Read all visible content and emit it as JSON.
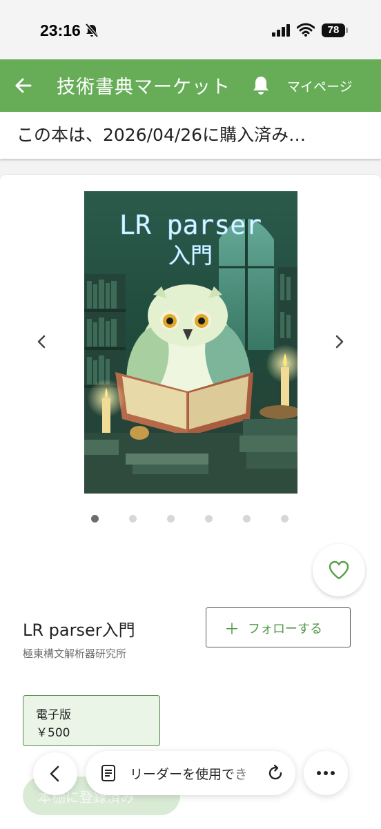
{
  "status_bar": {
    "time": "23:16",
    "battery": "78",
    "icons": [
      "bell-off-icon",
      "signal-icon",
      "wifi-icon",
      "battery-icon"
    ]
  },
  "app_bar": {
    "title": "技術書典マーケット",
    "mypage_label": "マイページ",
    "icons": [
      "back-arrow-icon",
      "bell-icon"
    ],
    "background": "#67ad58"
  },
  "purchase_notice": "この本は、2026/04/26に購入済み…",
  "book": {
    "cover_title_line1": "LR parser",
    "cover_title_line2": "入門",
    "title": "LR parser入門",
    "publisher": "極東構文解析器研究所",
    "follow_label": "フォローする",
    "edition": {
      "name": "電子版",
      "price": "￥500"
    },
    "registered_label": "本棚に登録済み"
  },
  "carousel": {
    "total": 6,
    "active_index": 0,
    "icons": [
      "chevron-left-icon",
      "chevron-right-icon"
    ]
  },
  "browser_bar": {
    "reader_text": "リーダーを使用でき",
    "icons": [
      "back-icon",
      "document-icon",
      "reload-icon",
      "more-icon"
    ]
  },
  "colors": {
    "accent": "#67ad58",
    "accent_text": "#4f9a45",
    "edition_bg": "#eaf5e8"
  }
}
